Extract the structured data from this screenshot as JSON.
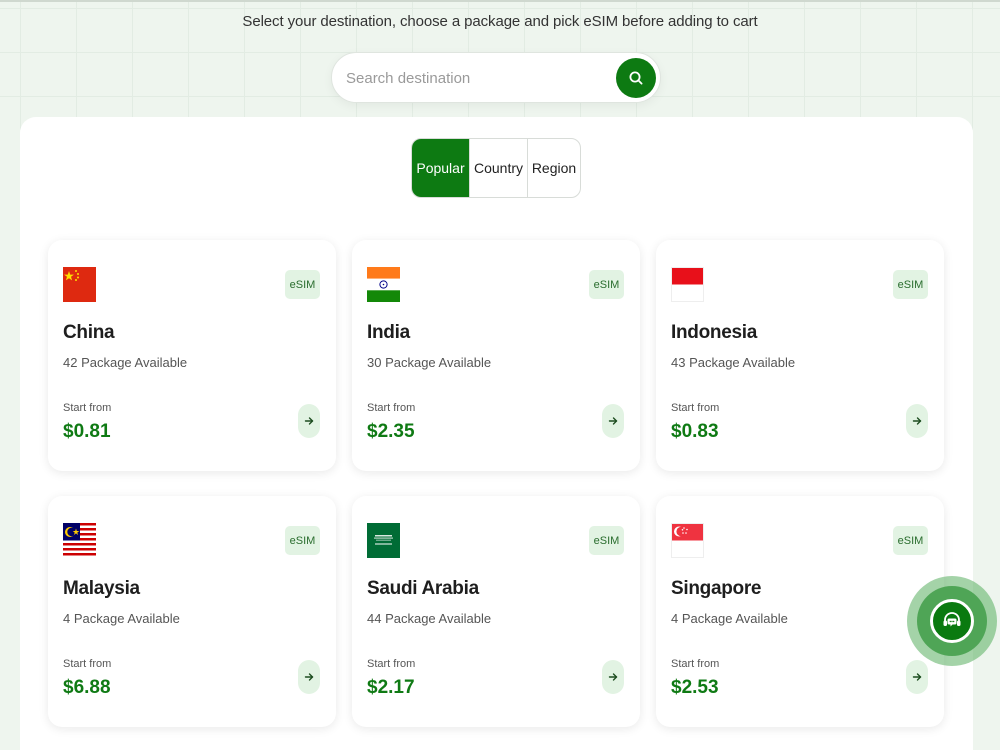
{
  "header": {
    "subtitle": "Select your destination, choose a package and pick eSIM before adding to cart"
  },
  "search": {
    "placeholder": "Search destination",
    "icon": "search-icon"
  },
  "tabs": [
    {
      "label": "Popular",
      "active": true
    },
    {
      "label": "Country",
      "active": false
    },
    {
      "label": "Region",
      "active": false
    }
  ],
  "destinations": [
    {
      "name": "China",
      "packages": "42 Package Available",
      "start_label": "Start from",
      "price": "$0.81",
      "badge": "eSIM",
      "flag": "china-flag"
    },
    {
      "name": "India",
      "packages": "30 Package Available",
      "start_label": "Start from",
      "price": "$2.35",
      "badge": "eSIM",
      "flag": "india-flag"
    },
    {
      "name": "Indonesia",
      "packages": "43 Package Available",
      "start_label": "Start from",
      "price": "$0.83",
      "badge": "eSIM",
      "flag": "indonesia-flag"
    },
    {
      "name": "Malaysia",
      "packages": "4 Package Available",
      "start_label": "Start from",
      "price": "$6.88",
      "badge": "eSIM",
      "flag": "malaysia-flag"
    },
    {
      "name": "Saudi Arabia",
      "packages": "44 Package Available",
      "start_label": "Start from",
      "price": "$2.17",
      "badge": "eSIM",
      "flag": "saudi-arabia-flag"
    },
    {
      "name": "Singapore",
      "packages": "4 Package Available",
      "start_label": "Start from",
      "price": "$2.53",
      "badge": "eSIM",
      "flag": "singapore-flag"
    }
  ],
  "support": {
    "icon": "support-chat-icon"
  },
  "colors": {
    "brand_green": "#0d7a12",
    "price_green": "#0f7a14",
    "badge_bg": "#e2f3e3",
    "page_bg": "#eef5ee"
  }
}
